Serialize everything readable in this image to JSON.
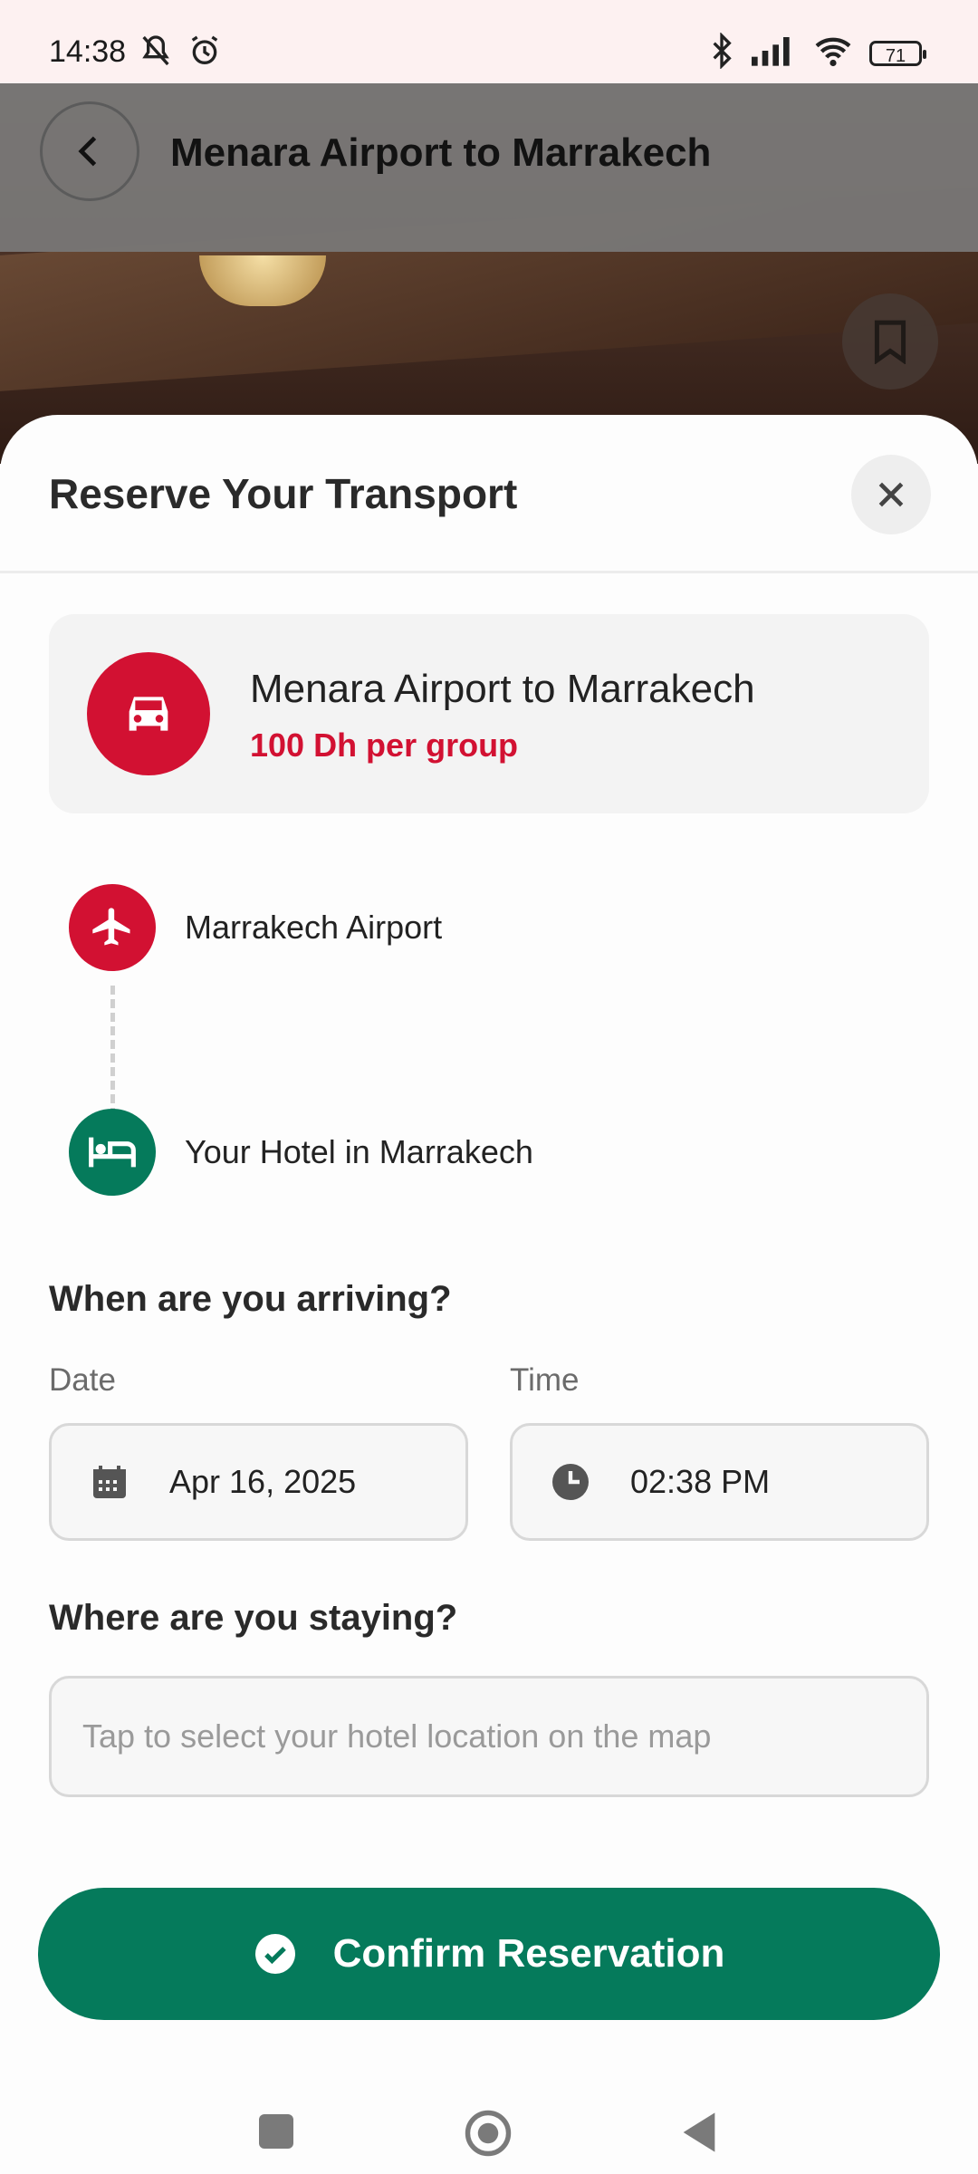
{
  "status_bar": {
    "time": "14:38",
    "battery": "71",
    "icons": [
      "mute-icon",
      "alarm-icon",
      "bluetooth-icon",
      "signal-icon",
      "wifi-icon",
      "battery-icon"
    ]
  },
  "header": {
    "title": "Menara Airport to Marrakech"
  },
  "sheet": {
    "title": "Reserve Your Transport",
    "route": {
      "name": "Menara Airport to Marrakech",
      "price": "100 Dh per group"
    },
    "stops": [
      {
        "label": "Marrakech Airport",
        "icon": "airplane-icon"
      },
      {
        "label": "Your Hotel in Marrakech",
        "icon": "bed-icon"
      }
    ],
    "arrival": {
      "question": "When are you arriving?",
      "date_label": "Date",
      "date_value": "Apr 16, 2025",
      "time_label": "Time",
      "time_value": "02:38 PM"
    },
    "staying": {
      "question": "Where are you staying?",
      "placeholder": "Tap to select your hotel location on the map"
    },
    "confirm_label": "Confirm Reservation"
  },
  "colors": {
    "primary_red": "#d21132",
    "primary_green": "#057a5b"
  }
}
